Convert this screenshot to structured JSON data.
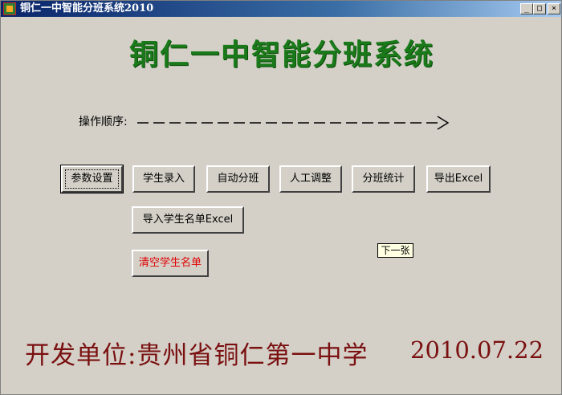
{
  "window": {
    "title": "铜仁一中智能分班系统2010",
    "controls": {
      "minimize": "_",
      "maximize": "□",
      "close": "×"
    }
  },
  "main": {
    "title": "铜仁一中智能分班系统",
    "sequence_label": "操作顺序:",
    "buttons": {
      "params": "参数设置",
      "student_entry": "学生录入",
      "auto_assign": "自动分班",
      "manual_adjust": "人工调整",
      "class_stats": "分班统计",
      "export_excel": "导出Excel",
      "import_excel": "导入学生名单Excel",
      "clear_list": "清空学生名单"
    },
    "tooltip": "下一张"
  },
  "footer": {
    "developer": "开发单位:贵州省铜仁第一中学",
    "date": "2010.07.22"
  },
  "colors": {
    "title_green": "#1a7a1a",
    "footer_red": "#7a1010",
    "clear_button_red": "#e00000",
    "titlebar_blue": "#0a246a"
  }
}
